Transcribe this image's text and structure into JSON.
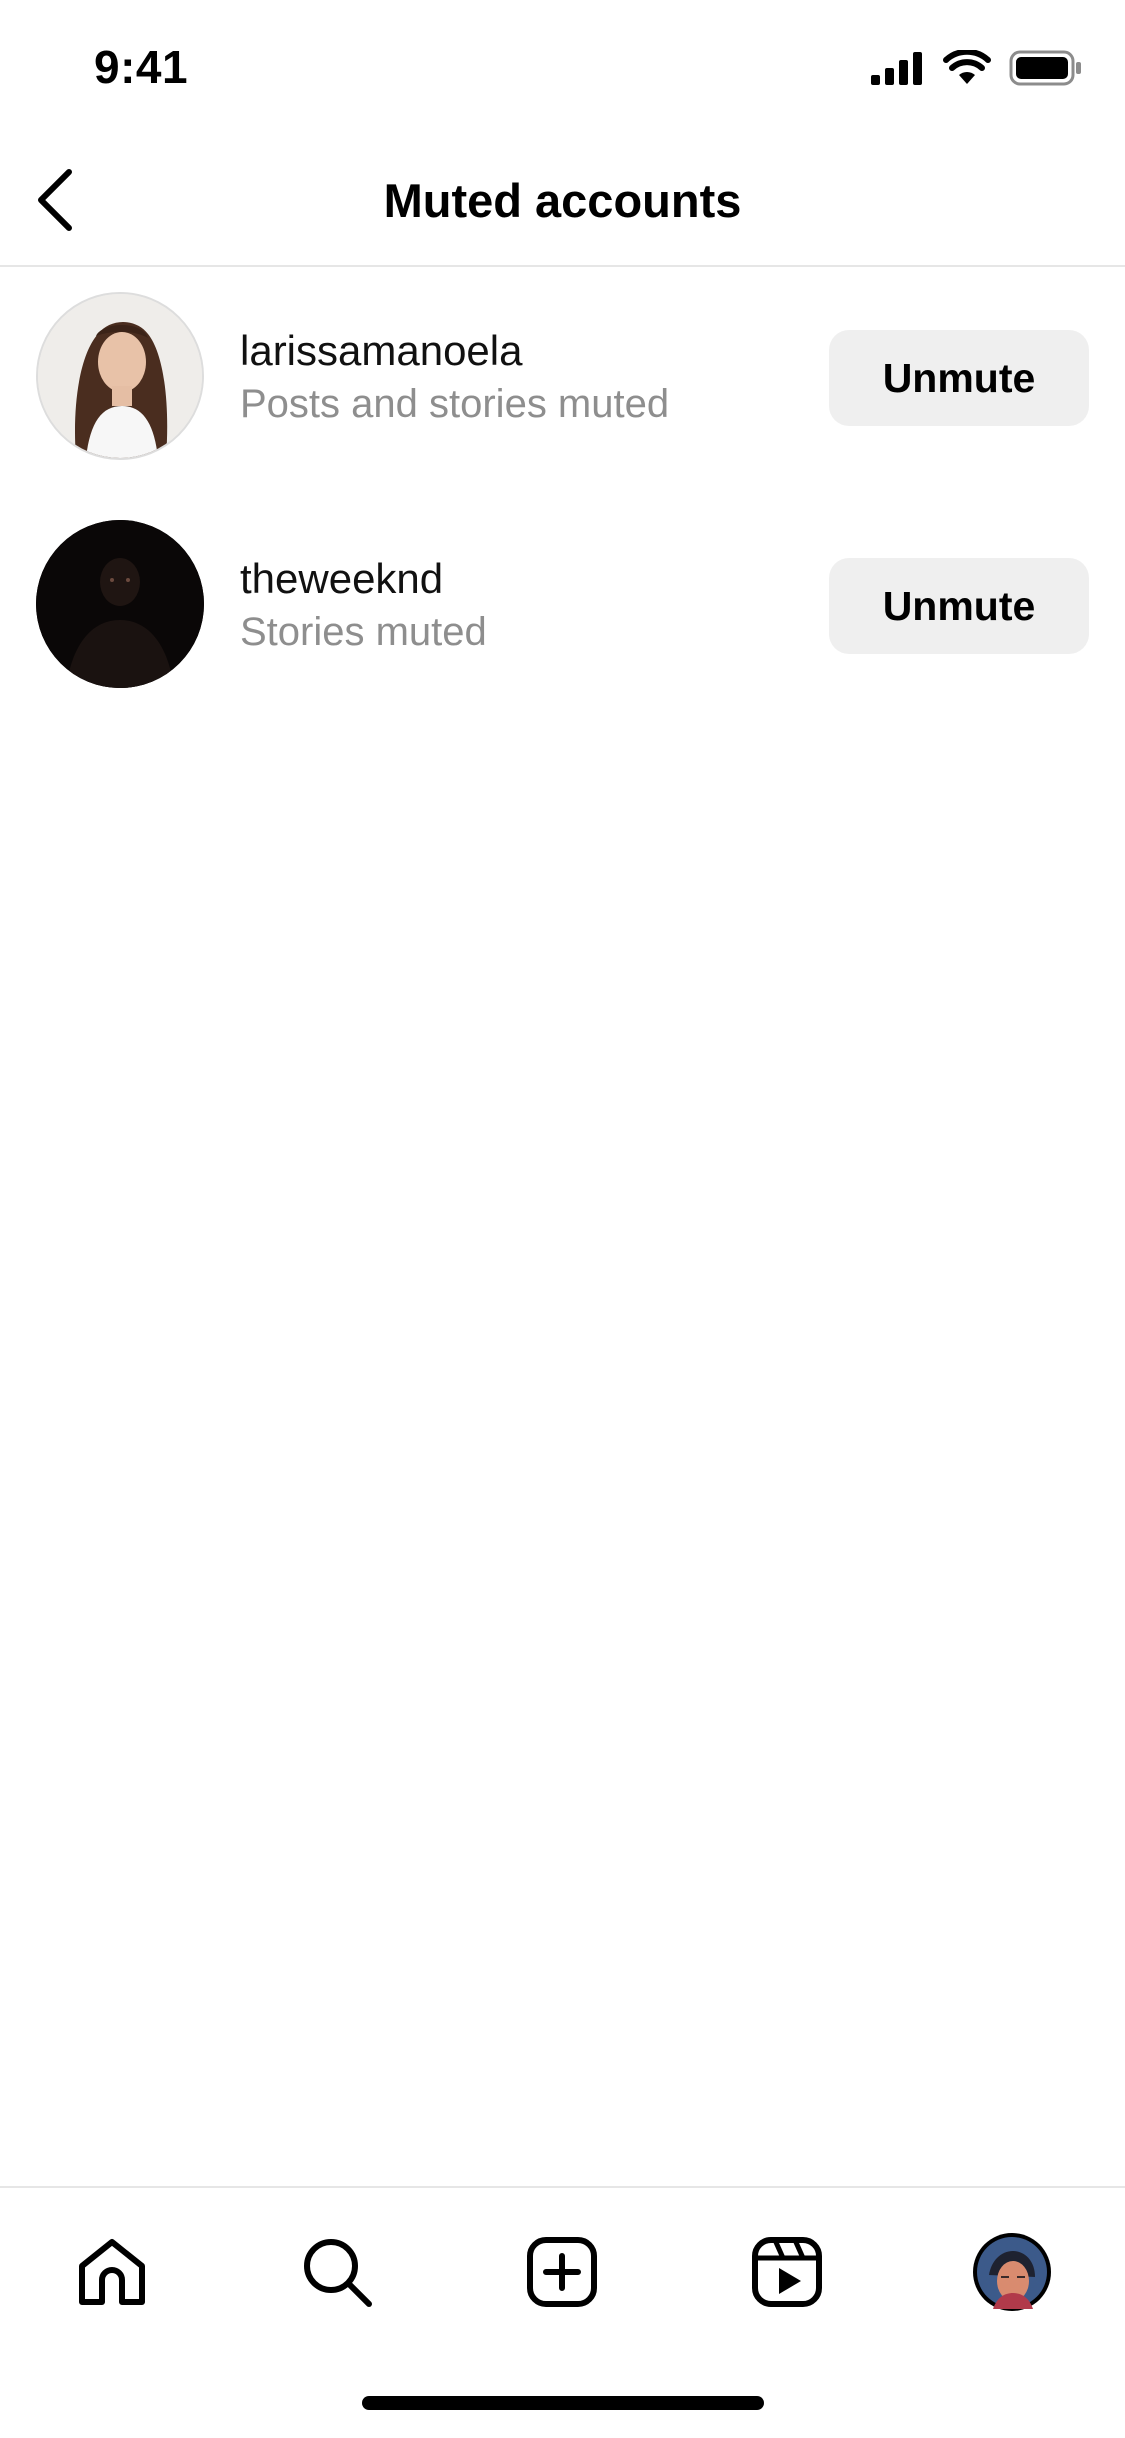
{
  "status": {
    "time": "9:41",
    "signal_icon": "cellular-signal-icon",
    "wifi_icon": "wifi-icon",
    "battery_icon": "battery-icon"
  },
  "nav": {
    "title": "Muted accounts",
    "back_icon": "chevron-left-icon"
  },
  "accounts": [
    {
      "username": "larissamanoela",
      "status": "Posts and stories muted",
      "button": "Unmute"
    },
    {
      "username": "theweeknd",
      "status": "Stories muted",
      "button": "Unmute"
    }
  ],
  "tabbar": {
    "items": [
      "home-icon",
      "search-icon",
      "new-post-icon",
      "reels-icon",
      "profile-avatar"
    ]
  },
  "colors": {
    "secondary_text": "#8e8e8e",
    "button_bg": "#efefef",
    "divider": "#e6e6e6"
  }
}
